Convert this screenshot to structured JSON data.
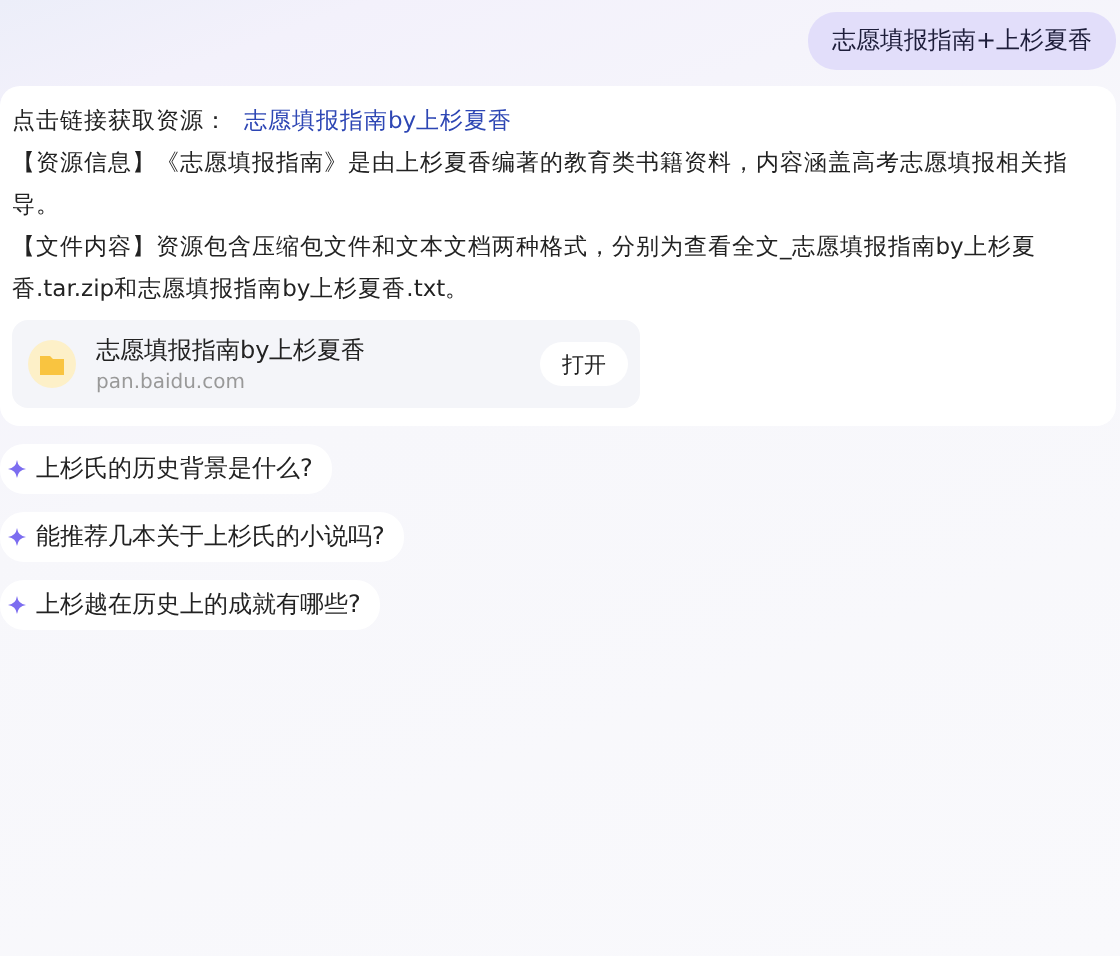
{
  "user_message": "志愿填报指南+上杉夏香",
  "answer": {
    "intro": "点击链接获取资源：",
    "link": "志愿填报指南by上杉夏香",
    "paragraphs": [
      "【资源信息】《志愿填报指南》是由上杉夏香编著的教育类书籍资料，内容涵盖高考志愿填报相关指导。",
      "【文件内容】资源包含压缩包文件和文本文档两种格式，分别为查看全文_志愿填报指南by上杉夏香.tar.zip和志愿填报指南by上杉夏香.txt。"
    ],
    "file_card": {
      "title": "志愿填报指南by上杉夏香",
      "source": "pan.baidu.com",
      "button": "打开"
    }
  },
  "suggestions": [
    "上杉氏的历史背景是什么?",
    "能推荐几本关于上杉氏的小说吗?",
    "上杉越在历史上的成就有哪些?"
  ]
}
